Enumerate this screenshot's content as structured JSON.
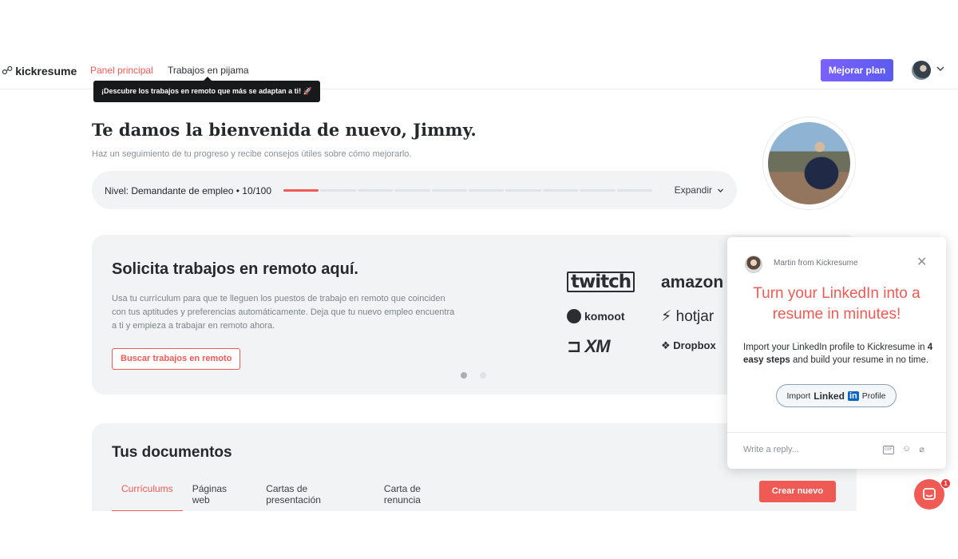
{
  "header": {
    "logo_text": "kickresume",
    "nav": [
      {
        "label": "Panel principal",
        "active": true
      },
      {
        "label": "Trabajos en pijama",
        "active": false
      }
    ],
    "tooltip": "¡Descubre los trabajos en remoto que más se adaptan a ti! 🚀",
    "upgrade_label": "Mejorar plan"
  },
  "welcome": {
    "title": "Te damos la bienvenida de nuevo, Jimmy.",
    "subtitle": "Haz un seguimiento de tu progreso y recibe consejos útiles sobre cómo mejorarlo.",
    "level_prefix": "Nivel: ",
    "level_value": "Demandante de empleo • 10/100",
    "progress": 0.1,
    "segments": 10,
    "expand_label": "Expandir"
  },
  "remote": {
    "title": "Solicita trabajos en remoto aquí.",
    "description": "Usa tu currículum para que te lleguen los puestos de trabajo en remoto que coinciden con tus aptitudes y preferencias automáticamente. Deja que tu nuevo empleo encuentra a ti y empieza a trabajar en remoto ahora.",
    "button": "Buscar trabajos en remoto",
    "brands": [
      "twitch",
      "amazon",
      "komoot",
      "hotjar",
      "XM",
      "Dropbox"
    ],
    "carousel_index": 1,
    "carousel_count": 2
  },
  "documents": {
    "title": "Tus documentos",
    "tabs": [
      "Currículums",
      "Páginas web",
      "Cartas de presentación",
      "Carta de renuncia"
    ],
    "active_tab": 0,
    "create_button": "Crear nuevo"
  },
  "chat": {
    "from": "Martin from Kickresume",
    "heading": "Turn your LinkedIn into a resume in minutes!",
    "body_1": "Import your LinkedIn profile to Kickresume in ",
    "body_bold": "4 easy steps",
    "body_2": " and build your resume in no time.",
    "btn_import": "Import",
    "btn_linked": "Linked",
    "btn_in": "in",
    "btn_profile": "Profile",
    "reply_placeholder": "Write a reply...",
    "gif_label": "GIF",
    "badge_count": "1"
  },
  "colors": {
    "accent": "#ef5a55",
    "upgrade": "#6c5ce7",
    "card_bg": "#f1f3f4"
  }
}
